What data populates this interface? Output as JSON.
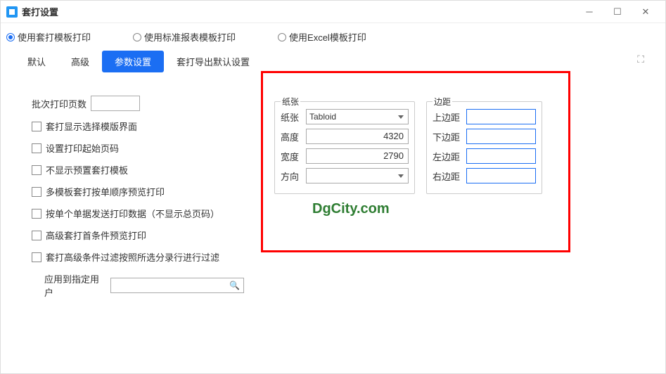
{
  "window": {
    "title": "套打设置"
  },
  "radios": {
    "opt1": "使用套打模板打印",
    "opt2": "使用标准报表模板打印",
    "opt3": "使用Excel模板打印"
  },
  "tabs": {
    "t1": "默认",
    "t2": "高级",
    "t3": "参数设置",
    "t4": "套打导出默认设置"
  },
  "left": {
    "batchPages": "批次打印页数",
    "chk1": "套打显示选择模版界面",
    "chk2": "设置打印起始页码",
    "chk3": "不显示预置套打模板",
    "chk4": "多模板套打按单顺序预览打印",
    "chk5": "按单个单据发送打印数据（不显示总页码）",
    "chk6": "高级套打首条件预览打印",
    "chk7": "套打高级条件过滤按照所选分录行进行过滤",
    "applyUser": "应用到指定用户"
  },
  "paper": {
    "legend": "纸张",
    "paperLabel": "纸张",
    "paperValue": "Tabloid",
    "heightLabel": "高度",
    "heightValue": "4320",
    "widthLabel": "宽度",
    "widthValue": "2790",
    "orientLabel": "方向"
  },
  "margin": {
    "legend": "边距",
    "top": "上边距",
    "bottom": "下边距",
    "left": "左边距",
    "right": "右边距"
  },
  "watermark": "DgCity.com"
}
